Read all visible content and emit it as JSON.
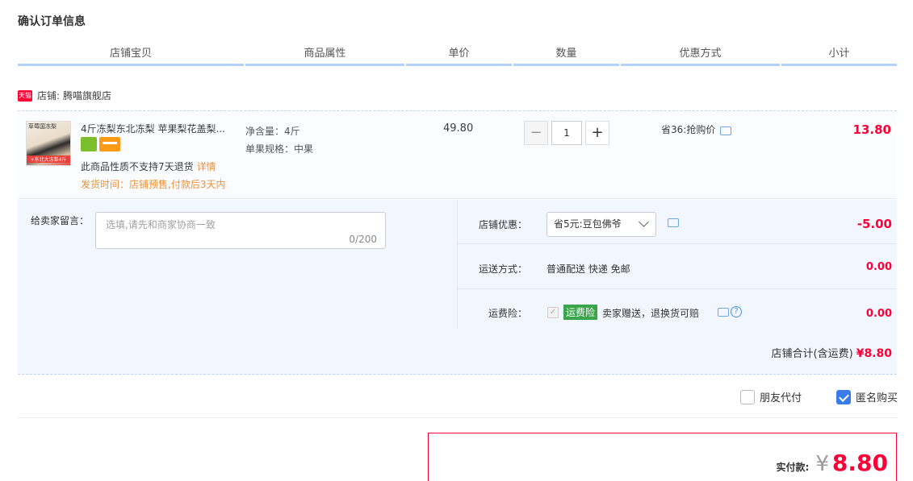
{
  "page_title": "确认订单信息",
  "columns": [
    "店铺宝贝",
    "商品属性",
    "单价",
    "数量",
    "优惠方式",
    "小计"
  ],
  "shop": {
    "label": "店铺:",
    "name": "腾喵旗舰店",
    "badge": "天猫"
  },
  "item": {
    "thumb_top": "草莓国冻梨",
    "thumb_bottom": "+东北大冻梨4斤",
    "name": "4斤冻梨东北冻梨 苹果梨花盖梨...",
    "no_return": "此商品性质不支持7天退货",
    "no_return_link": "详情",
    "ship_time": "发货时间：店铺预售,付款后3天内",
    "attr_weight": "净含量：4斤",
    "attr_spec": "单果规格：中果",
    "unit_price": "49.80",
    "quantity": "1",
    "qty_minus": "−",
    "qty_plus": "+",
    "promo": "省36:抢购价",
    "subtotal": "13.80"
  },
  "services": {
    "message_label": "给卖家留言：",
    "message_placeholder": "选填,请先和商家协商一致",
    "message_count": "0/200",
    "coupon_label": "店铺优惠：",
    "coupon_value": "省5元:豆包佛爷",
    "coupon_amount": "-5.00",
    "ship_label": "运送方式：",
    "ship_value": "普通配送 快递 免邮",
    "ship_amount": "0.00",
    "insurance_label": "运费险：",
    "insurance_tag": "运费险",
    "insurance_desc": "卖家赠送，退换货可赔",
    "insurance_amount": "0.00",
    "shop_total_label": "店铺合计(含运费)",
    "shop_total_value": "¥8.80"
  },
  "options": {
    "friend_pay": "朋友代付",
    "friend_pay_checked": false,
    "anonymous": "匿名购买",
    "anonymous_checked": true
  },
  "payment": {
    "label": "实付款:",
    "currency": "¥",
    "amount": "8.80"
  },
  "colors": {
    "accent_red": "#ff0036",
    "header_line": "#b2d1ff",
    "service_bg": "#f2f7ff",
    "checkbox_blue": "#3a7bea",
    "insurance_green": "#3aa54a",
    "notice_orange": "#e9923a"
  }
}
